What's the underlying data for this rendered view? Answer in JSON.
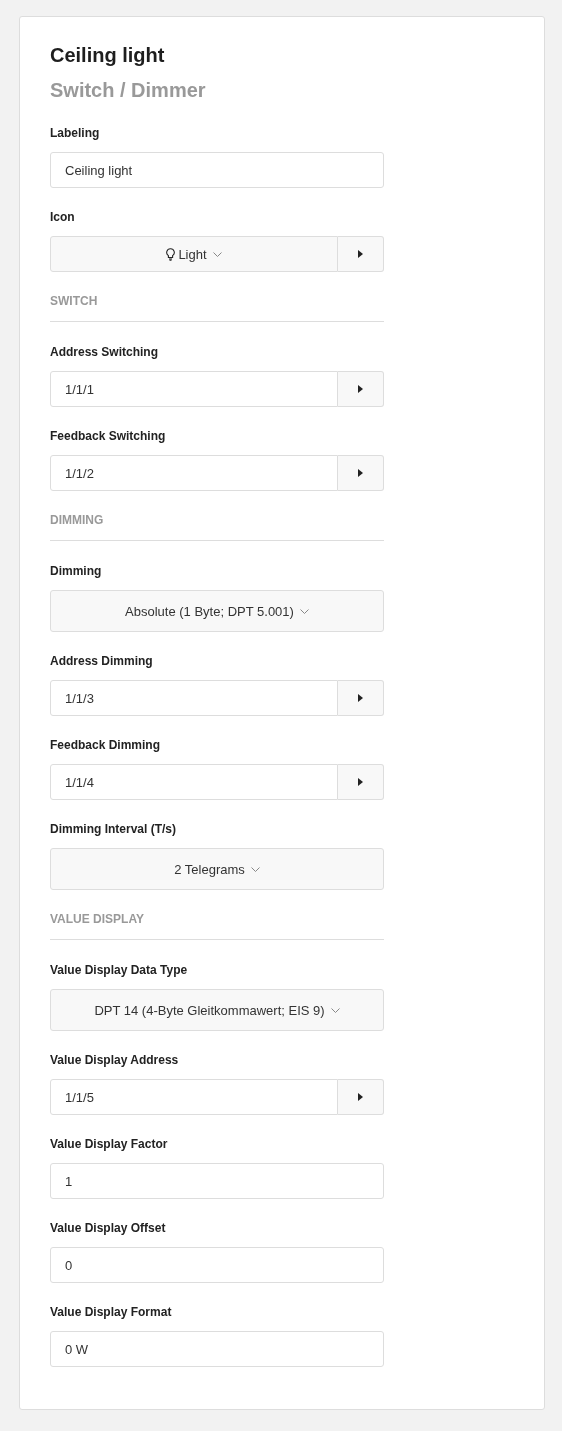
{
  "title": "Ceiling light",
  "subtitle": "Switch / Dimmer",
  "items": [
    {
      "kind": "text",
      "label": "Labeling",
      "value": "Ceiling light"
    },
    {
      "kind": "iconselect",
      "label": "Icon",
      "value": "Light"
    },
    {
      "kind": "section",
      "label": "SWITCH"
    },
    {
      "kind": "address",
      "label": "Address Switching",
      "value": "1/1/1"
    },
    {
      "kind": "address",
      "label": "Feedback Switching",
      "value": "1/1/2"
    },
    {
      "kind": "section",
      "label": "DIMMING"
    },
    {
      "kind": "select",
      "label": "Dimming",
      "value": "Absolute (1 Byte; DPT 5.001)"
    },
    {
      "kind": "address",
      "label": "Address Dimming",
      "value": "1/1/3"
    },
    {
      "kind": "address",
      "label": "Feedback Dimming",
      "value": "1/1/4"
    },
    {
      "kind": "select",
      "label": "Dimming Interval (T/s)",
      "value": "2 Telegrams"
    },
    {
      "kind": "section",
      "label": "VALUE DISPLAY"
    },
    {
      "kind": "select",
      "label": "Value Display Data Type",
      "value": "DPT 14 (4-Byte Gleitkommawert; EIS 9)"
    },
    {
      "kind": "address",
      "label": "Value Display Address",
      "value": "1/1/5"
    },
    {
      "kind": "text",
      "label": "Value Display Factor",
      "value": "1"
    },
    {
      "kind": "text",
      "label": "Value Display Offset",
      "value": "0"
    },
    {
      "kind": "text",
      "label": "Value Display Format",
      "value": "0 W"
    }
  ]
}
